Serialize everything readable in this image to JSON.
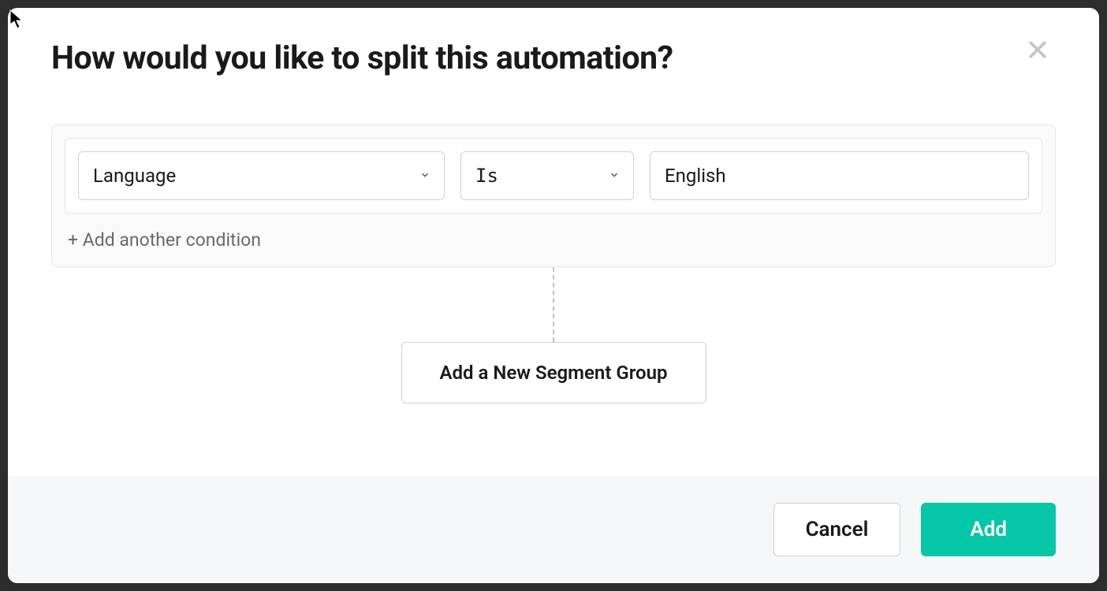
{
  "modal": {
    "title": "How would you like to split this automation?"
  },
  "condition": {
    "field": "Language",
    "operator": "Is",
    "value": "English",
    "addAnother": "+ Add another condition"
  },
  "segment": {
    "addNewGroup": "Add a New Segment Group"
  },
  "footer": {
    "cancel": "Cancel",
    "add": "Add"
  }
}
